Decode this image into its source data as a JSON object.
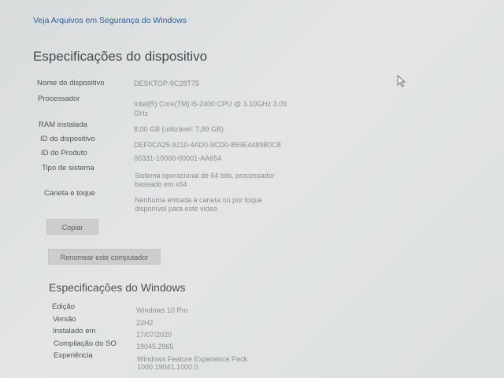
{
  "top_link": "Veja Arquivos em Segurança do Windows",
  "device_section": {
    "title": "Especificações do dispositivo",
    "rows": [
      {
        "label": "Nome do dispositivo",
        "value": "DESKTOP-9C28T75"
      },
      {
        "label": "Processador",
        "value": "Intel(R) Core(TM) i5-2400 CPU @ 3.10GHz 3.09",
        "value2": "GHz"
      },
      {
        "label": "RAM instalada",
        "value": "8,00 GB (utilizável: 7,89 GB)"
      },
      {
        "label": "ID do dispositivo",
        "value": "DEF0CA25-9210-4AD0-9CD0-859E4489B0C8"
      },
      {
        "label": "ID do Produto",
        "value": "00331-10000-00001-AA654"
      },
      {
        "label": "Tipo de sistema",
        "value": "Sistema operacional de 64 bits, processador",
        "value2": "baseado em x64"
      },
      {
        "label": "Caneta e toque",
        "value": "Nenhuma entrada à caneta ou por toque",
        "value2": "disponível para este vídeo"
      }
    ],
    "copy_button": "Copiar",
    "rename_button": "Renomear este computador"
  },
  "windows_section": {
    "title": "Especificações do Windows",
    "rows": [
      {
        "label": "Edição",
        "value": "Windows 10 Pro"
      },
      {
        "label": "Versão",
        "value": "22H2"
      },
      {
        "label": "Instalado em",
        "value": "17/07/2020"
      },
      {
        "label": "Compilação do SO",
        "value": "19045.2965"
      },
      {
        "label": "Experiência",
        "value": "Windows Feature Experience Pack",
        "value2": "1000.19041.1000.0"
      }
    ]
  }
}
